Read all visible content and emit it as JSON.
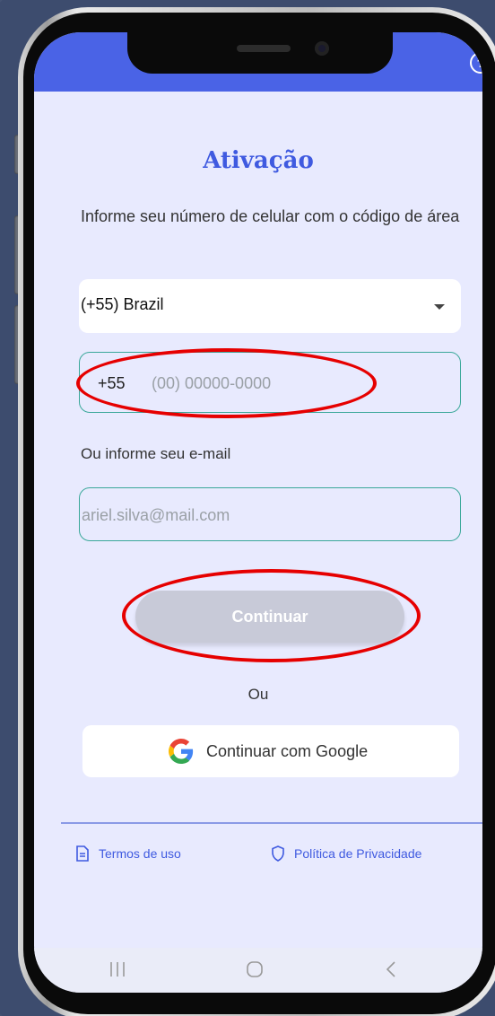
{
  "screen": {
    "title": "Ativação",
    "instructions": "Informe seu número de celular com o código de área",
    "country_select": {
      "value": "(+55) Brazil"
    },
    "phone": {
      "prefix": "+55",
      "placeholder": "(00) 00000-0000"
    },
    "email_label": "Ou informe seu e-mail",
    "email": {
      "placeholder": "ariel.silva@mail.com"
    },
    "continue_label": "Continuar",
    "or_text": "Ou",
    "google_label": "Continuar com Google"
  },
  "footer": {
    "terms": "Termos de uso",
    "privacy": "Política de Privacidade"
  },
  "colors": {
    "accent": "#4a63e6",
    "field_border": "#3aa89a",
    "annotation": "#e60000"
  }
}
